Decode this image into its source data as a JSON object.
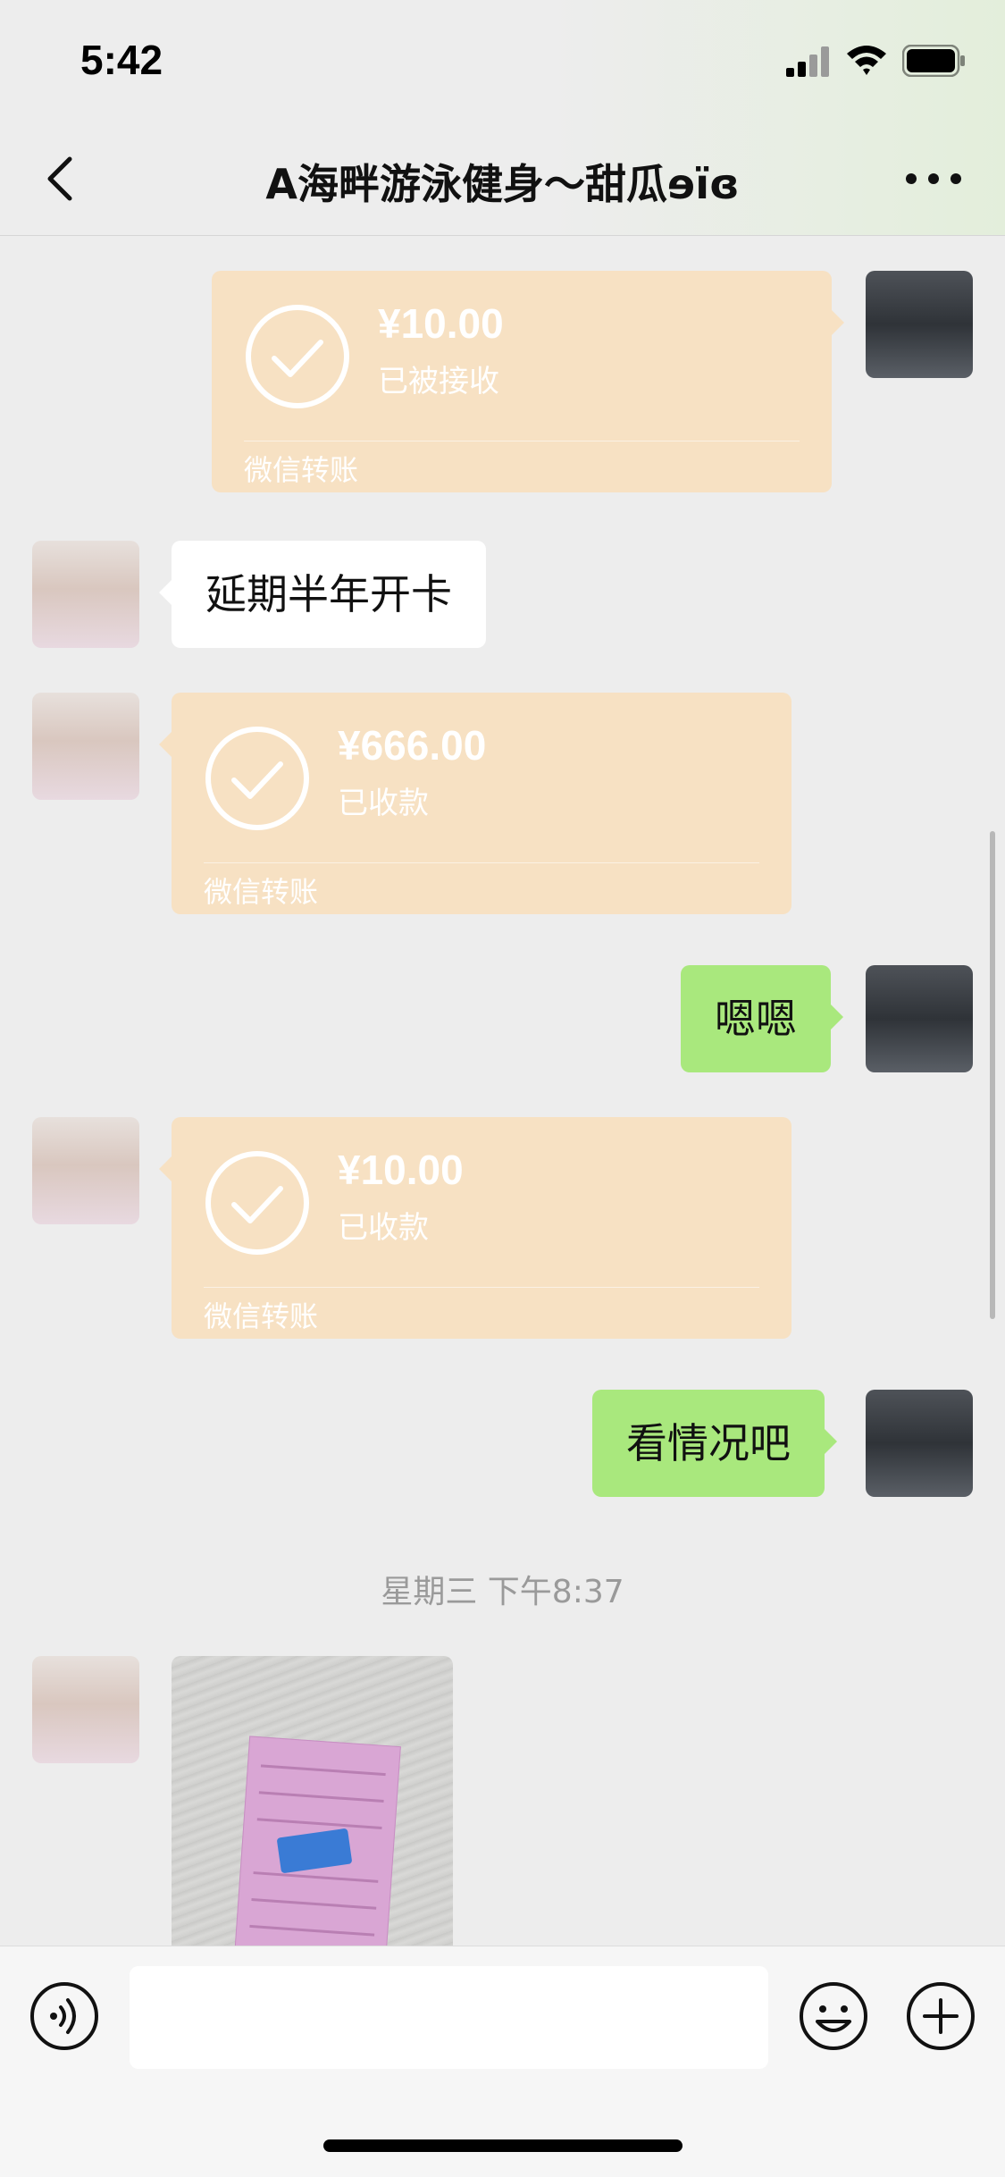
{
  "status_bar": {
    "time": "5:42"
  },
  "nav": {
    "title": "A海畔游泳健身～甜瓜ɘïɞ"
  },
  "messages": {
    "m1": {
      "amount": "¥10.00",
      "status": "已被接收",
      "footer": "微信转账"
    },
    "m2": {
      "text": "延期半年开卡"
    },
    "m3": {
      "amount": "¥666.00",
      "status": "已收款",
      "footer": "微信转账"
    },
    "m4": {
      "text": "嗯嗯"
    },
    "m5": {
      "amount": "¥10.00",
      "status": "已收款",
      "footer": "微信转账"
    },
    "m6": {
      "text": "看情况吧"
    },
    "timestamp": "星期三 下午8:37"
  },
  "input": {
    "placeholder": ""
  },
  "colors": {
    "background": "#ededed",
    "transfer": "#f7e1c3",
    "sent_bubble": "#a9e87d",
    "received_bubble": "#ffffff"
  },
  "icons": [
    "back-icon",
    "more-icon",
    "check-icon",
    "voice-icon",
    "emoji-icon",
    "plus-icon"
  ]
}
